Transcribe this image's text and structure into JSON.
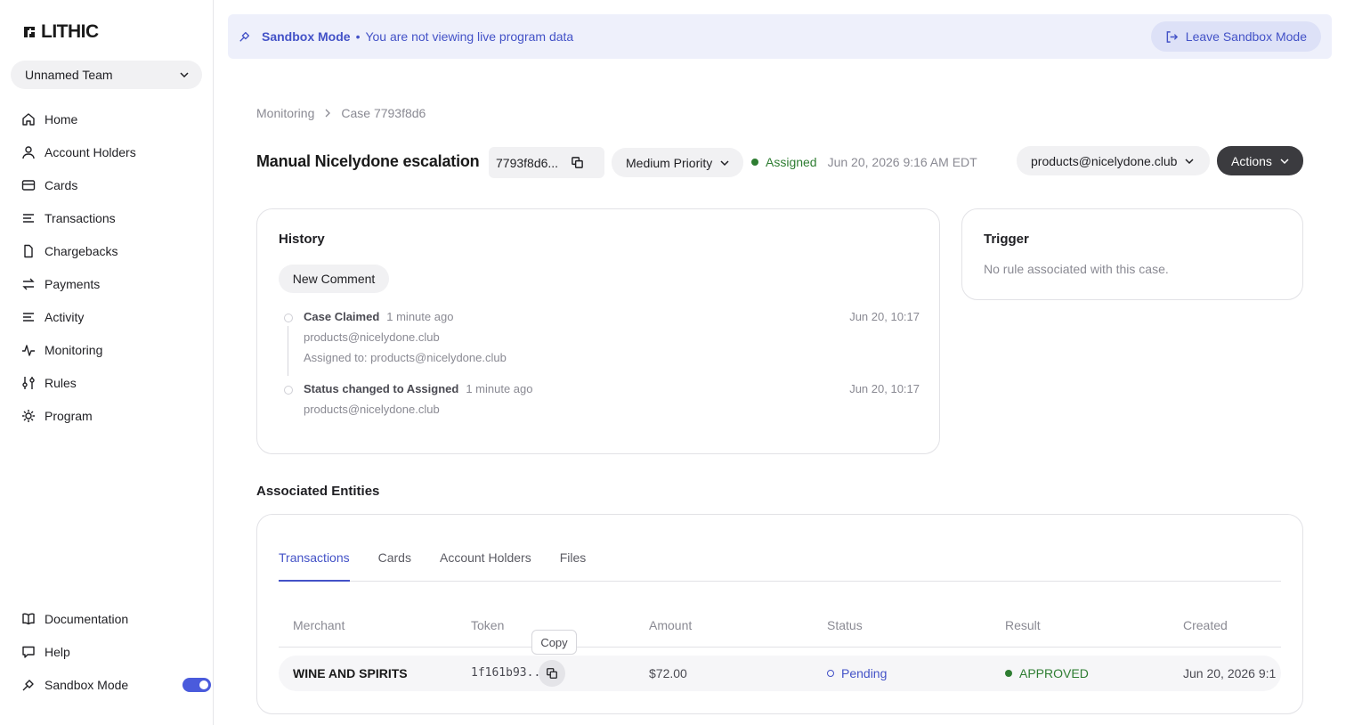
{
  "brand": {
    "logo_text": "LITHIC"
  },
  "sidebar": {
    "team": "Unnamed Team",
    "items": [
      {
        "label": "Home",
        "icon": "home-icon"
      },
      {
        "label": "Account Holders",
        "icon": "user-icon"
      },
      {
        "label": "Cards",
        "icon": "card-icon"
      },
      {
        "label": "Transactions",
        "icon": "list-icon"
      },
      {
        "label": "Chargebacks",
        "icon": "document-icon"
      },
      {
        "label": "Payments",
        "icon": "arrows-icon"
      },
      {
        "label": "Activity",
        "icon": "list-icon"
      },
      {
        "label": "Monitoring",
        "icon": "pulse-icon"
      },
      {
        "label": "Rules",
        "icon": "sliders-icon"
      },
      {
        "label": "Program",
        "icon": "gear-icon"
      }
    ],
    "bottom": [
      {
        "label": "Documentation",
        "icon": "book-icon"
      },
      {
        "label": "Help",
        "icon": "chat-icon"
      },
      {
        "label": "Sandbox Mode",
        "icon": "sandbox-icon",
        "toggle_on": true
      }
    ]
  },
  "banner": {
    "title": "Sandbox Mode",
    "separator": "•",
    "message": "You are not viewing live program data",
    "leave_label": "Leave Sandbox Mode"
  },
  "breadcrumb": {
    "parent": "Monitoring",
    "current": "Case 7793f8d6"
  },
  "case": {
    "title": "Manual Nicelydone escalation",
    "id_short": "7793f8d6...",
    "priority": "Medium Priority",
    "status": "Assigned",
    "status_date": "Jun 20, 2026 9:16 AM EDT",
    "assignee": "products@nicelydone.club",
    "actions_label": "Actions"
  },
  "history": {
    "title": "History",
    "new_comment": "New Comment",
    "events": [
      {
        "name": "Case Claimed",
        "ago": "1 minute ago",
        "time": "Jun 20, 10:17",
        "line1": "products@nicelydone.club",
        "line2": "Assigned to: products@nicelydone.club"
      },
      {
        "name": "Status changed to Assigned",
        "ago": "1 minute ago",
        "time": "Jun 20, 10:17",
        "line1": "products@nicelydone.club",
        "line2": ""
      }
    ]
  },
  "trigger": {
    "title": "Trigger",
    "text": "No rule associated with this case."
  },
  "entities": {
    "title": "Associated Entities",
    "tabs": [
      "Transactions",
      "Cards",
      "Account Holders",
      "Files"
    ],
    "active_tab": "Transactions",
    "columns": [
      "Merchant",
      "Token",
      "Amount",
      "Status",
      "Result",
      "Created"
    ],
    "rows": [
      {
        "merchant": "WINE AND SPIRITS",
        "token": "1f161b93...",
        "amount": "$72.00",
        "status": "Pending",
        "result": "APPROVED",
        "created": "Jun 20, 2026 9:1"
      }
    ],
    "tooltip": "Copy"
  }
}
